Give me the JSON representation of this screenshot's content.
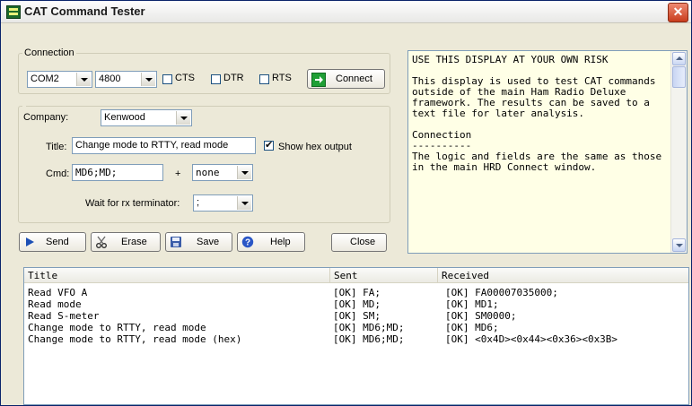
{
  "window": {
    "title": "CAT Command Tester",
    "close": "✕"
  },
  "connection": {
    "legend": "Connection",
    "port": "COM2",
    "baud": "4800",
    "cts_label": "CTS",
    "dtr_label": "DTR",
    "rts_label": "RTS",
    "connect_label": "Connect"
  },
  "company": {
    "label": "Company:",
    "value": "Kenwood",
    "title_label": "Title:",
    "title_value": "Change mode to RTTY, read mode",
    "show_hex_label": "Show hex output",
    "cmd_label": "Cmd:",
    "cmd_value": "MD6;MD;",
    "plus": "+",
    "suffix_value": "none",
    "wait_label": "Wait for rx terminator:",
    "wait_value": ";"
  },
  "toolbar": {
    "send": "Send",
    "erase": "Erase",
    "save": "Save",
    "help": "Help",
    "close": "Close"
  },
  "info_text": "USE THIS DISPLAY AT YOUR OWN RISK\n\nThis display is used to test CAT commands outside of the main Ham Radio Deluxe framework. The results can be saved to a text file for later analysis.\n\nConnection\n----------\nThe logic and fields are the same as those in the main HRD Connect window.",
  "table": {
    "columns": [
      "Title",
      "Sent",
      "Received"
    ],
    "rows": [
      {
        "title": "Read VFO A",
        "sent": "[OK] FA;",
        "received": "[OK] FA00007035000;"
      },
      {
        "title": "Read mode",
        "sent": "[OK] MD;",
        "received": "[OK] MD1;"
      },
      {
        "title": "Read S-meter",
        "sent": "[OK] SM;",
        "received": "[OK] SM0000;"
      },
      {
        "title": "Change mode to RTTY, read mode",
        "sent": "[OK] MD6;MD;",
        "received": "[OK] MD6;"
      },
      {
        "title": "Change mode to RTTY, read mode (hex)",
        "sent": "[OK] MD6;MD;",
        "received": "[OK] <0x4D><0x44><0x36><0x3B>"
      }
    ]
  }
}
